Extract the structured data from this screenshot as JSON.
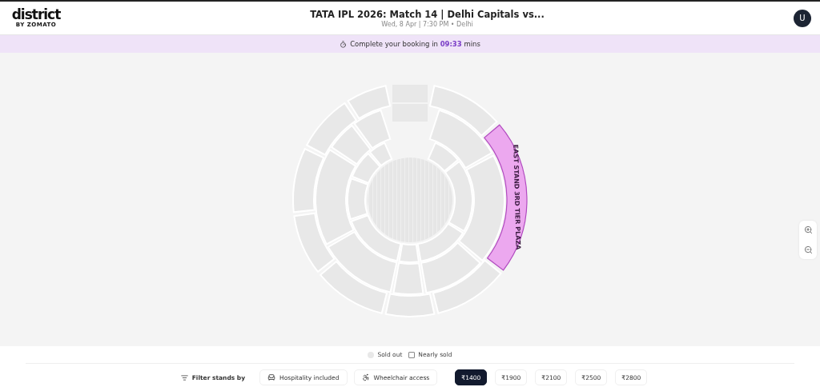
{
  "header": {
    "logo": "district",
    "logo_sub": "BY ZOMATO",
    "title": "TATA IPL 2026: Match 14 | Delhi Capitals vs...",
    "subtitle": "Wed, 8 Apr | 7:30 PM • Delhi",
    "avatar": "U"
  },
  "timer": {
    "prefix": "Complete your booking in",
    "time": "09:33",
    "suffix": "mins"
  },
  "stands": [
    {
      "selected": false
    },
    {
      "selected": true,
      "label": "EAST STAND 3RD TIER PLAZA"
    },
    {
      "selected": false
    },
    {
      "selected": false
    },
    {
      "selected": false
    },
    {
      "selected": false
    },
    {
      "selected": false
    },
    {
      "selected": false
    },
    {
      "selected": false
    },
    {
      "selected": false
    },
    {
      "selected": false
    },
    {
      "selected": false
    },
    {
      "selected": false
    },
    {
      "selected": false
    },
    {
      "selected": false
    },
    {
      "selected": false
    },
    {
      "selected": false
    },
    {
      "selected": false
    },
    {
      "selected": false
    },
    {
      "selected": false
    },
    {
      "selected": false
    },
    {
      "selected": false
    },
    {
      "selected": false
    },
    {
      "selected": false
    },
    {
      "selected": false
    }
  ],
  "legend": [
    {
      "kind": "dot",
      "label": "Sold out"
    },
    {
      "kind": "square",
      "label": "Nearly sold"
    }
  ],
  "filter": {
    "label": "Filter stands by",
    "options": [
      {
        "kind": "hospitality",
        "label": "Hospitality included"
      },
      {
        "kind": "wheelchair",
        "label": "Wheelchair access"
      }
    ]
  },
  "prices": [
    {
      "label": "₹1400",
      "selected": true
    },
    {
      "label": "₹1900",
      "selected": false
    },
    {
      "label": "₹2100",
      "selected": false
    },
    {
      "label": "₹2500",
      "selected": false
    },
    {
      "label": "₹2800",
      "selected": false
    }
  ]
}
